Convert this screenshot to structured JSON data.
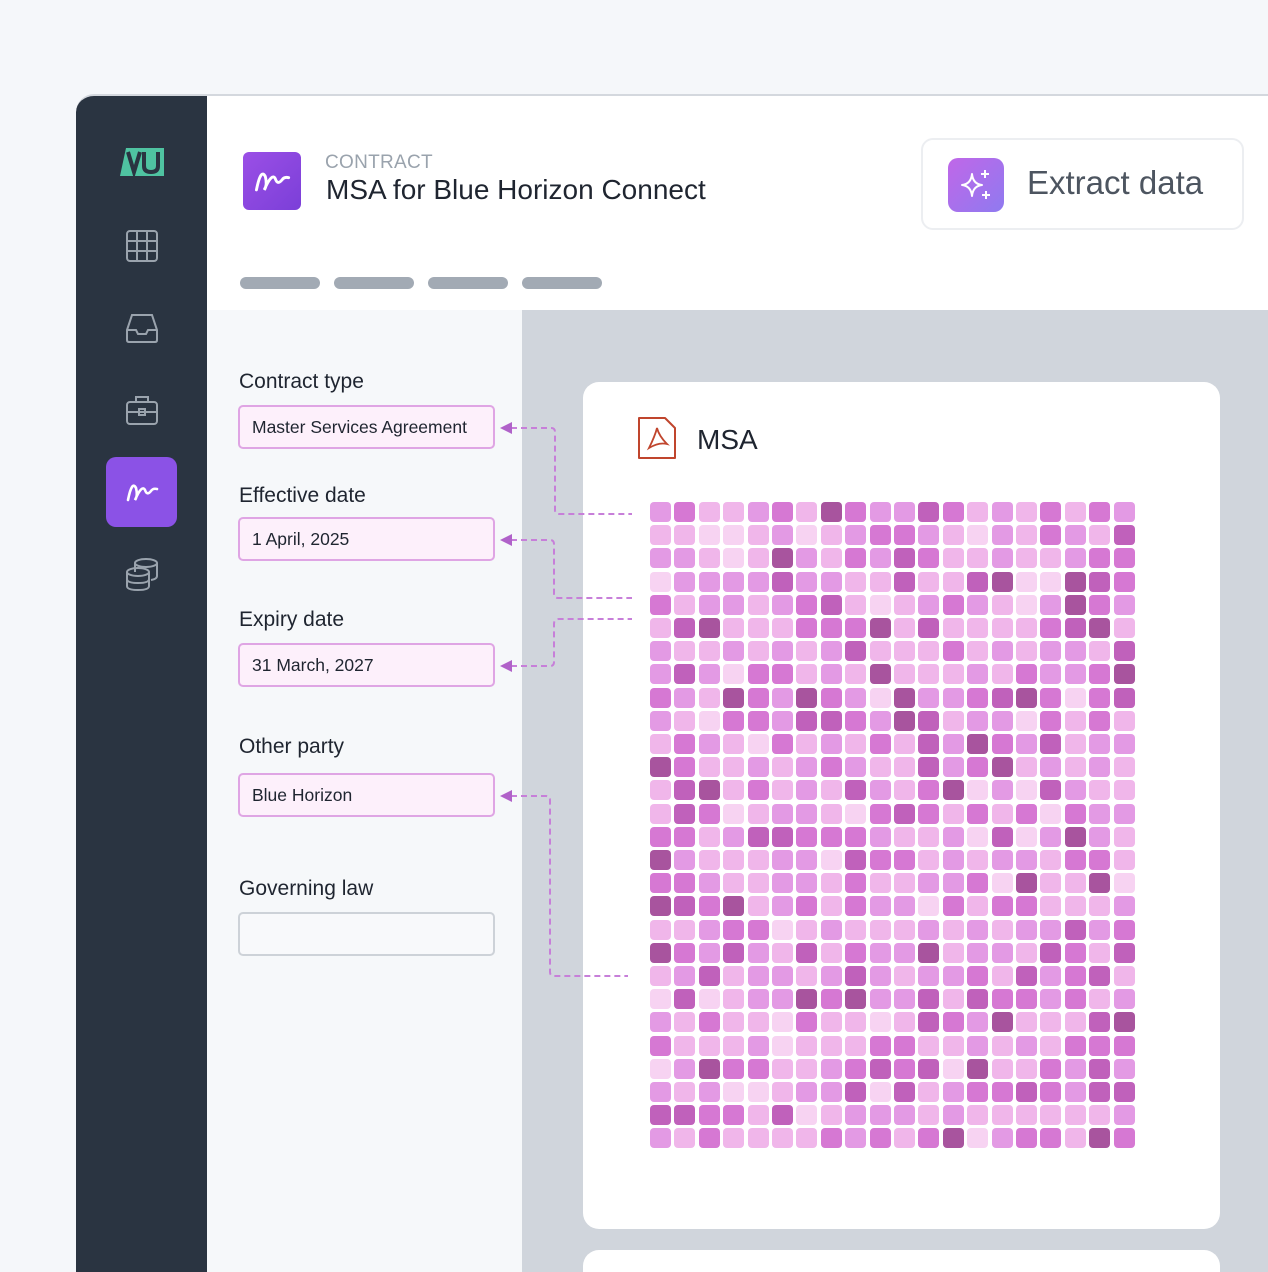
{
  "header": {
    "doc_type": "CONTRACT",
    "doc_title": "MSA for Blue Horizon Connect",
    "extract_label": "Extract data"
  },
  "sidebar": {
    "items": [
      {
        "icon": "table-grid-icon"
      },
      {
        "icon": "inbox-tray-icon"
      },
      {
        "icon": "briefcase-icon"
      },
      {
        "icon": "signature-icon",
        "active": true
      },
      {
        "icon": "database-stack-icon"
      }
    ]
  },
  "form": {
    "contract_type": {
      "label": "Contract type",
      "value": "Master Services Agreement"
    },
    "effective_date": {
      "label": "Effective date",
      "value": "1 April, 2025"
    },
    "expiry_date": {
      "label": "Expiry date",
      "value": "31 March, 2027"
    },
    "other_party": {
      "label": "Other party",
      "value": "Blue Horizon"
    },
    "governing_law": {
      "label": "Governing law",
      "value": ""
    }
  },
  "viewer": {
    "doc_name": "MSA"
  },
  "colors": {
    "sidebar": "#2a3441",
    "accent": "#8b52e6",
    "field_border": "#dfa5e4",
    "connector": "#c77fd9",
    "cell_palette": [
      "#f0b6ea",
      "#e39ae4",
      "#d678d3",
      "#c061bb",
      "#a8549e",
      "#f7d3f2"
    ]
  }
}
